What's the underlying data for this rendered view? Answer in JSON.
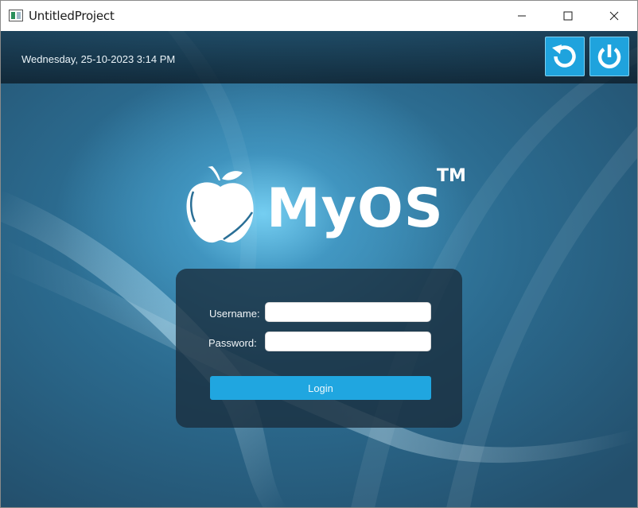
{
  "window": {
    "title": "UntitledProject"
  },
  "header": {
    "datetime": "Wednesday, 25-10-2023 3:14 PM",
    "refresh_icon": "refresh-icon",
    "power_icon": "power-icon"
  },
  "logo": {
    "text": "MyOS",
    "trademark": "TM",
    "icon": "apple-icon"
  },
  "login": {
    "username_label": "Username:",
    "password_label": "Password:",
    "username_value": "",
    "password_value": "",
    "button_label": "Login"
  },
  "colors": {
    "accent": "#1fa3dd",
    "panel": "#192d3c",
    "background_dark": "#234f6c",
    "background_glow": "#78d2f5"
  }
}
